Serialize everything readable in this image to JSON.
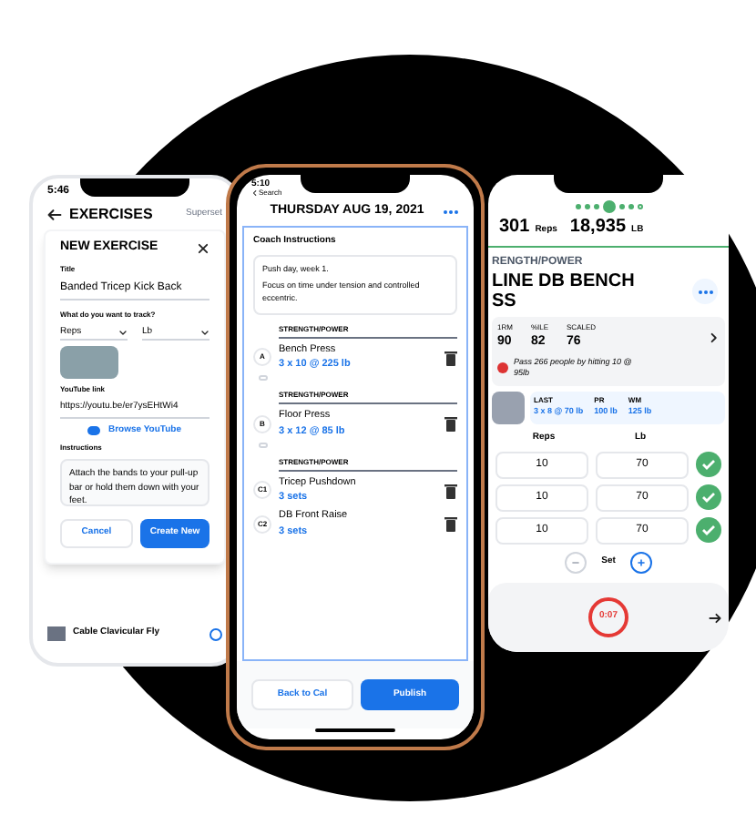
{
  "left_phone": {
    "time": "5:46",
    "nav_title": "EXERCISES",
    "nav_action": "Superset",
    "dialog": {
      "title": "NEW EXERCISE",
      "title_label": "Title",
      "title_value": "Banded Tricep Kick Back",
      "track_label": "What do you want to track?",
      "track_fields": [
        {
          "value": "Reps"
        },
        {
          "value": "Lb"
        }
      ],
      "youtube_label": "YouTube link",
      "youtube_value": "https://youtu.be/er7ysEHtWi4",
      "browse": "Browse YouTube",
      "instructions_label": "Instructions",
      "instructions_value": "Attach the bands to your pull-up bar or hold them down with your feet.",
      "cancel": "Cancel",
      "create": "Create New"
    },
    "list_item": "Cable Clavicular Fly"
  },
  "center_phone": {
    "time": "5:10",
    "back": "Search",
    "title": "THURSDAY AUG 19, 2021",
    "coach_label": "Coach Instructions",
    "coach_lines": [
      "Push day, week 1.",
      "Focus on time under tension and controlled eccentric."
    ],
    "blocks": [
      {
        "category": "STRENGTH/POWER",
        "linked": true,
        "exercises": [
          {
            "letter": "A",
            "name": "Bench Press",
            "sets": "3 x 10 @ 225 lb"
          }
        ]
      },
      {
        "category": "STRENGTH/POWER",
        "linked": true,
        "exercises": [
          {
            "letter": "B",
            "name": "Floor Press",
            "sets": "3 x 12 @ 85 lb"
          }
        ]
      },
      {
        "category": "STRENGTH/POWER",
        "linked": false,
        "exercises": [
          {
            "letter": "C1",
            "name": "Tricep Pushdown",
            "sets": "3 sets"
          },
          {
            "letter": "C2",
            "name": "DB Front Raise",
            "sets": "3 sets"
          }
        ]
      }
    ],
    "back_button": "Back to Cal",
    "publish_button": "Publish"
  },
  "right_phone": {
    "dots": [
      {
        "done": true,
        "selected": false
      },
      {
        "done": true,
        "selected": false
      },
      {
        "done": true,
        "selected": false
      },
      {
        "done": true,
        "selected": true
      },
      {
        "done": true,
        "selected": false
      },
      {
        "done": true,
        "selected": false
      },
      {
        "done": false,
        "selected": false
      }
    ],
    "reps": "301",
    "reps_unit": "Reps",
    "weight": "18,935",
    "weight_unit": "LB",
    "category": "RENGTH/POWER",
    "title_lines": [
      "LINE DB BENCH",
      "SS"
    ],
    "metrics": [
      {
        "label": "1RM",
        "value": "90"
      },
      {
        "label": "%ILE",
        "value": "82"
      },
      {
        "label": "SCALED",
        "value": "76"
      }
    ],
    "note": "Pass 266 people by hitting 10 @ 95lb",
    "history": [
      {
        "label": "LAST",
        "value": "3 x 8 @ 70 lb"
      },
      {
        "label": "PR",
        "value": "100 lb"
      },
      {
        "label": "WM",
        "value": "125 lb"
      }
    ],
    "columns": [
      "Reps",
      "Lb"
    ],
    "rows": [
      {
        "reps": "10",
        "lb": "70",
        "done": true
      },
      {
        "reps": "10",
        "lb": "70",
        "done": true
      },
      {
        "reps": "10",
        "lb": "70",
        "done": true
      }
    ],
    "set_label": "Set",
    "timer": "0:07"
  }
}
